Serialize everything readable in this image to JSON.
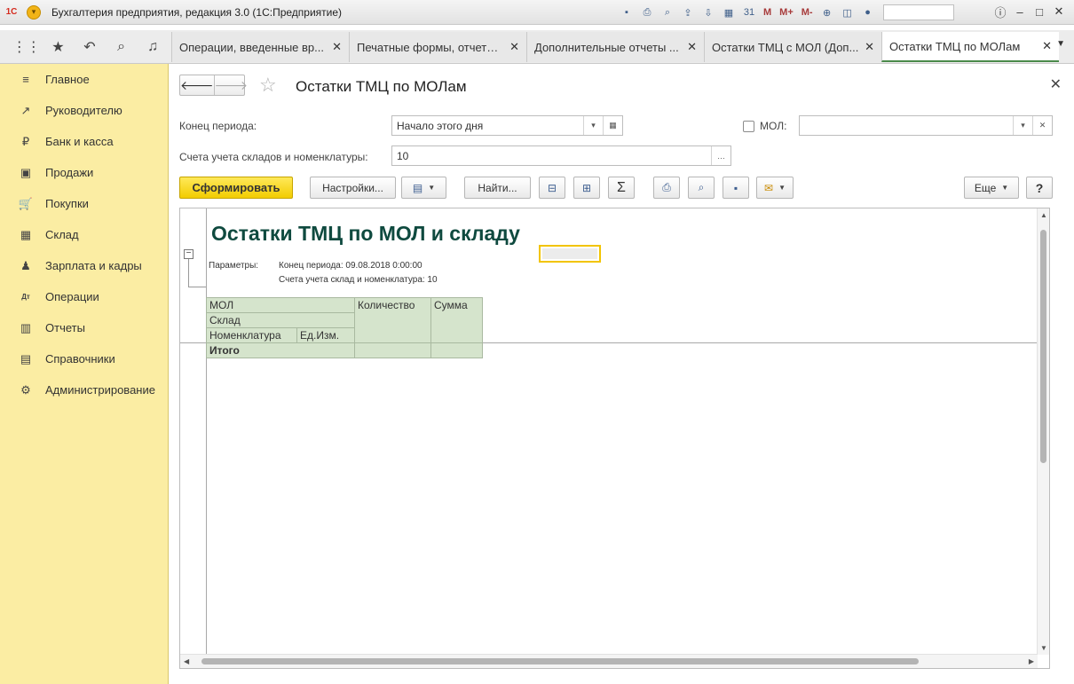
{
  "titlebar": {
    "logo": "1С",
    "title": "Бухгалтерия предприятия, редакция 3.0  (1С:Предприятие)",
    "tools": [
      "save-icon",
      "print-icon",
      "preview-icon",
      "upload-icon",
      "download-icon",
      "calculator-icon",
      "calendar-icon"
    ],
    "m_labels": [
      "M",
      "M+",
      "M-"
    ],
    "calendar_day": "31"
  },
  "topnav": {
    "icons": [
      "apps-grid-icon",
      "favorites-star-icon",
      "history-icon",
      "search-icon",
      "notifications-bell-icon"
    ]
  },
  "tabs": [
    {
      "label": "Операции, введенные вр...",
      "active": false
    },
    {
      "label": "Печатные формы, отчеты ...",
      "active": false
    },
    {
      "label": "Дополнительные отчеты ...",
      "active": false
    },
    {
      "label": "Остатки ТМЦ с МОЛ (Доп...",
      "active": false
    },
    {
      "label": "Остатки ТМЦ по МОЛам",
      "active": true
    }
  ],
  "sidebar": {
    "items": [
      {
        "label": "Главное",
        "icon": "menu-lines-icon",
        "glyph": "≡"
      },
      {
        "label": "Руководителю",
        "icon": "trend-up-icon",
        "glyph": "↗"
      },
      {
        "label": "Банк и касса",
        "icon": "ruble-coin-icon",
        "glyph": "₽"
      },
      {
        "label": "Продажи",
        "icon": "shopping-bag-icon",
        "glyph": "▣"
      },
      {
        "label": "Покупки",
        "icon": "cart-icon",
        "glyph": "🛒"
      },
      {
        "label": "Склад",
        "icon": "warehouse-grid-icon",
        "glyph": "▦"
      },
      {
        "label": "Зарплата и кадры",
        "icon": "person-icon",
        "glyph": "♟"
      },
      {
        "label": "Операции",
        "icon": "debit-credit-icon",
        "glyph": "Дт"
      },
      {
        "label": "Отчеты",
        "icon": "bar-chart-icon",
        "glyph": "▥"
      },
      {
        "label": "Справочники",
        "icon": "books-icon",
        "glyph": "▤"
      },
      {
        "label": "Администрирование",
        "icon": "gear-icon",
        "glyph": "⚙"
      }
    ]
  },
  "form": {
    "title": "Остатки ТМЦ по МОЛам",
    "period_label": "Конец периода:",
    "period_value": "Начало этого дня",
    "accounts_label": "Счета учета складов и номенклатуры:",
    "accounts_value": "10",
    "mol_label": "МОЛ:",
    "mol_value": "",
    "mol_checked": false
  },
  "toolbar": {
    "generate": "Сформировать",
    "settings": "Настройки...",
    "find": "Найти...",
    "sum": "Σ",
    "more": "Еще",
    "help": "?"
  },
  "report": {
    "title": "Остатки ТМЦ по МОЛ и складу",
    "params_label": "Параметры:",
    "param_period": "Конец периода: 09.08.2018 0:00:00",
    "param_accounts": "Счета учета склад и номенклатура: 10",
    "headers": {
      "mol": "МОЛ",
      "warehouse": "Склад",
      "nomenclature": "Номенклатура",
      "unit": "Ед.Изм.",
      "quantity": "Количество",
      "sum": "Сумма"
    },
    "total": "Итого"
  }
}
